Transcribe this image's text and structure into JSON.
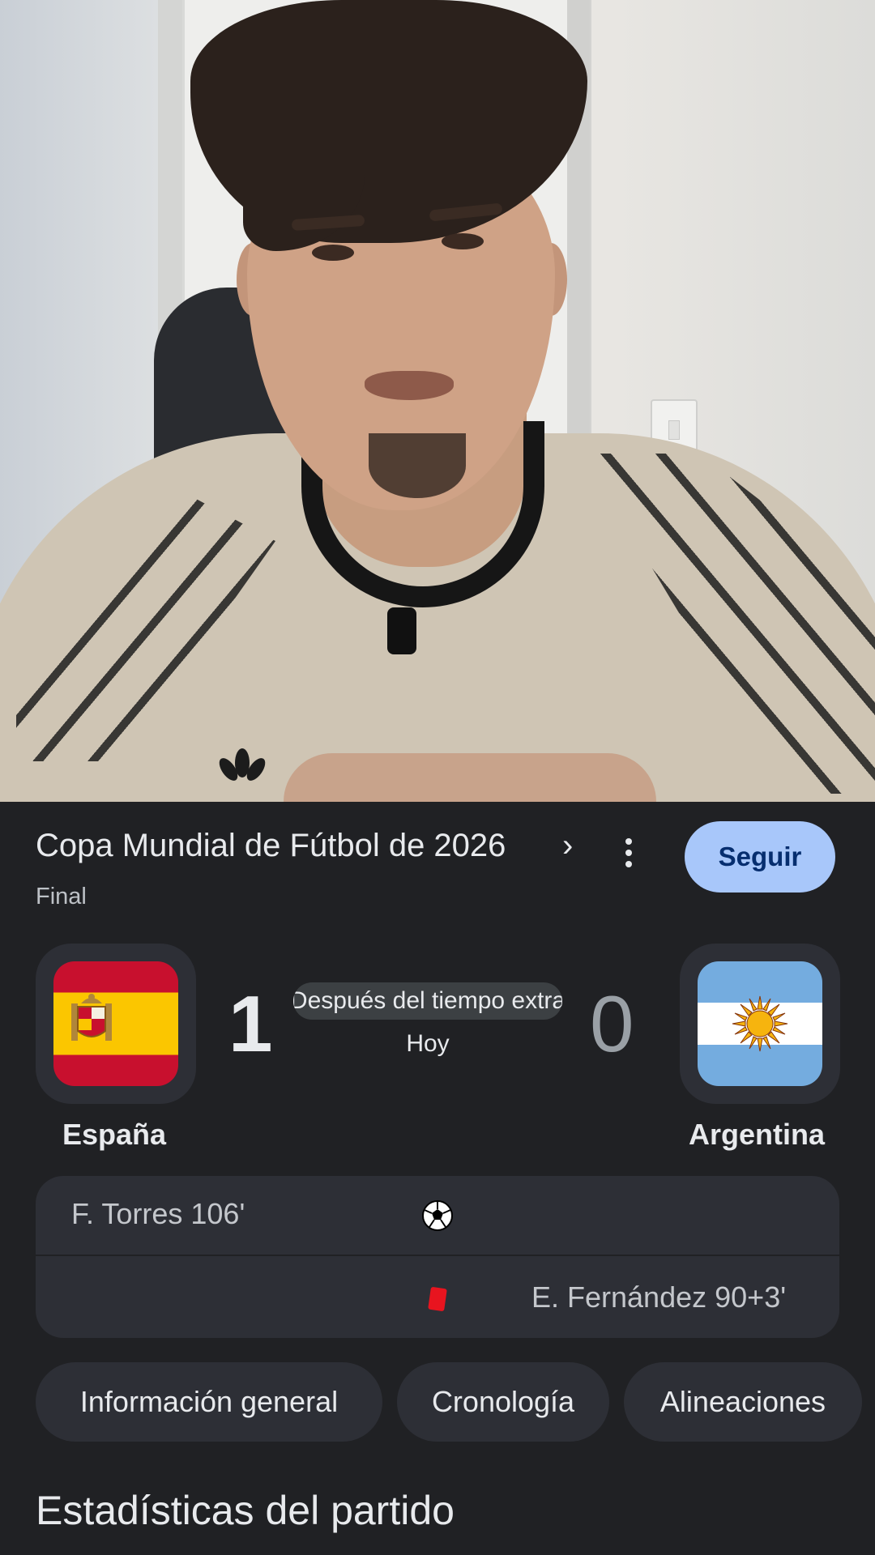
{
  "competition": {
    "title": "Copa Mundial de Fútbol de 2026",
    "chevron": "›",
    "stage": "Final",
    "follow_label": "Seguir"
  },
  "match": {
    "home": {
      "name": "España",
      "score": "1",
      "flag": "spain-flag-icon"
    },
    "away": {
      "name": "Argentina",
      "score": "0",
      "flag": "argentina-flag-icon"
    },
    "status": "Después del tiempo extra",
    "date": "Hoy"
  },
  "events": [
    {
      "side": "home",
      "text": "F. Torres 106'",
      "icon": "soccer-ball-icon"
    },
    {
      "side": "away",
      "text": "E. Fernández 90+3'",
      "icon": "red-card-icon"
    }
  ],
  "tabs": [
    "Información general",
    "Cronología",
    "Alineaciones"
  ],
  "section": {
    "title": "Estadísticas del partido"
  },
  "colors": {
    "background": "#202124",
    "card": "#2d2f36",
    "follow_button": "#a8c7fa",
    "red_card": "#e8141f"
  }
}
